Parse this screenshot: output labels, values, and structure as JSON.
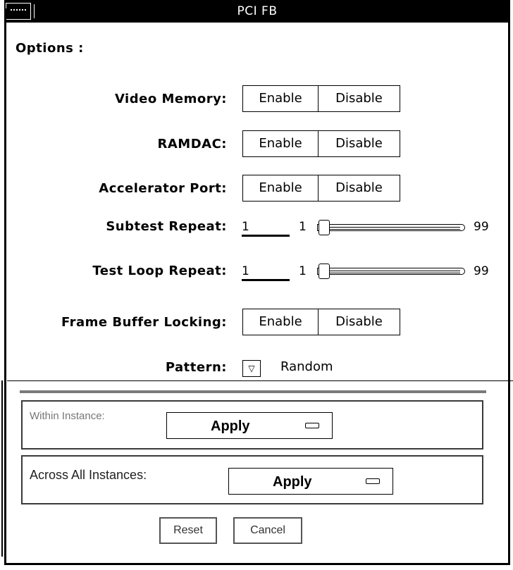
{
  "window": {
    "title": "PCI FB"
  },
  "options": {
    "heading": "Options :",
    "rows": [
      {
        "label": "Video Memory:",
        "enable": "Enable",
        "disable": "Disable"
      },
      {
        "label": "RAMDAC:",
        "enable": "Enable",
        "disable": "Disable"
      },
      {
        "label": "Accelerator Port:",
        "enable": "Enable",
        "disable": "Disable"
      }
    ],
    "subtest_repeat": {
      "label": "Subtest Repeat:",
      "value": "1",
      "min": "1",
      "max": "99"
    },
    "test_loop_repeat": {
      "label": "Test Loop Repeat:",
      "value": "1",
      "min": "1",
      "max": "99"
    },
    "frame_buffer_locking": {
      "label": "Frame Buffer Locking:",
      "enable": "Enable",
      "disable": "Disable"
    },
    "pattern": {
      "label": "Pattern:",
      "value": "Random",
      "menu_icon": "triangle-down-icon"
    }
  },
  "within_instance": {
    "label": "Within Instance:",
    "apply": "Apply"
  },
  "across_all_instances": {
    "label": "Across All Instances:",
    "apply": "Apply"
  },
  "footer": {
    "reset": "Reset",
    "cancel": "Cancel"
  }
}
